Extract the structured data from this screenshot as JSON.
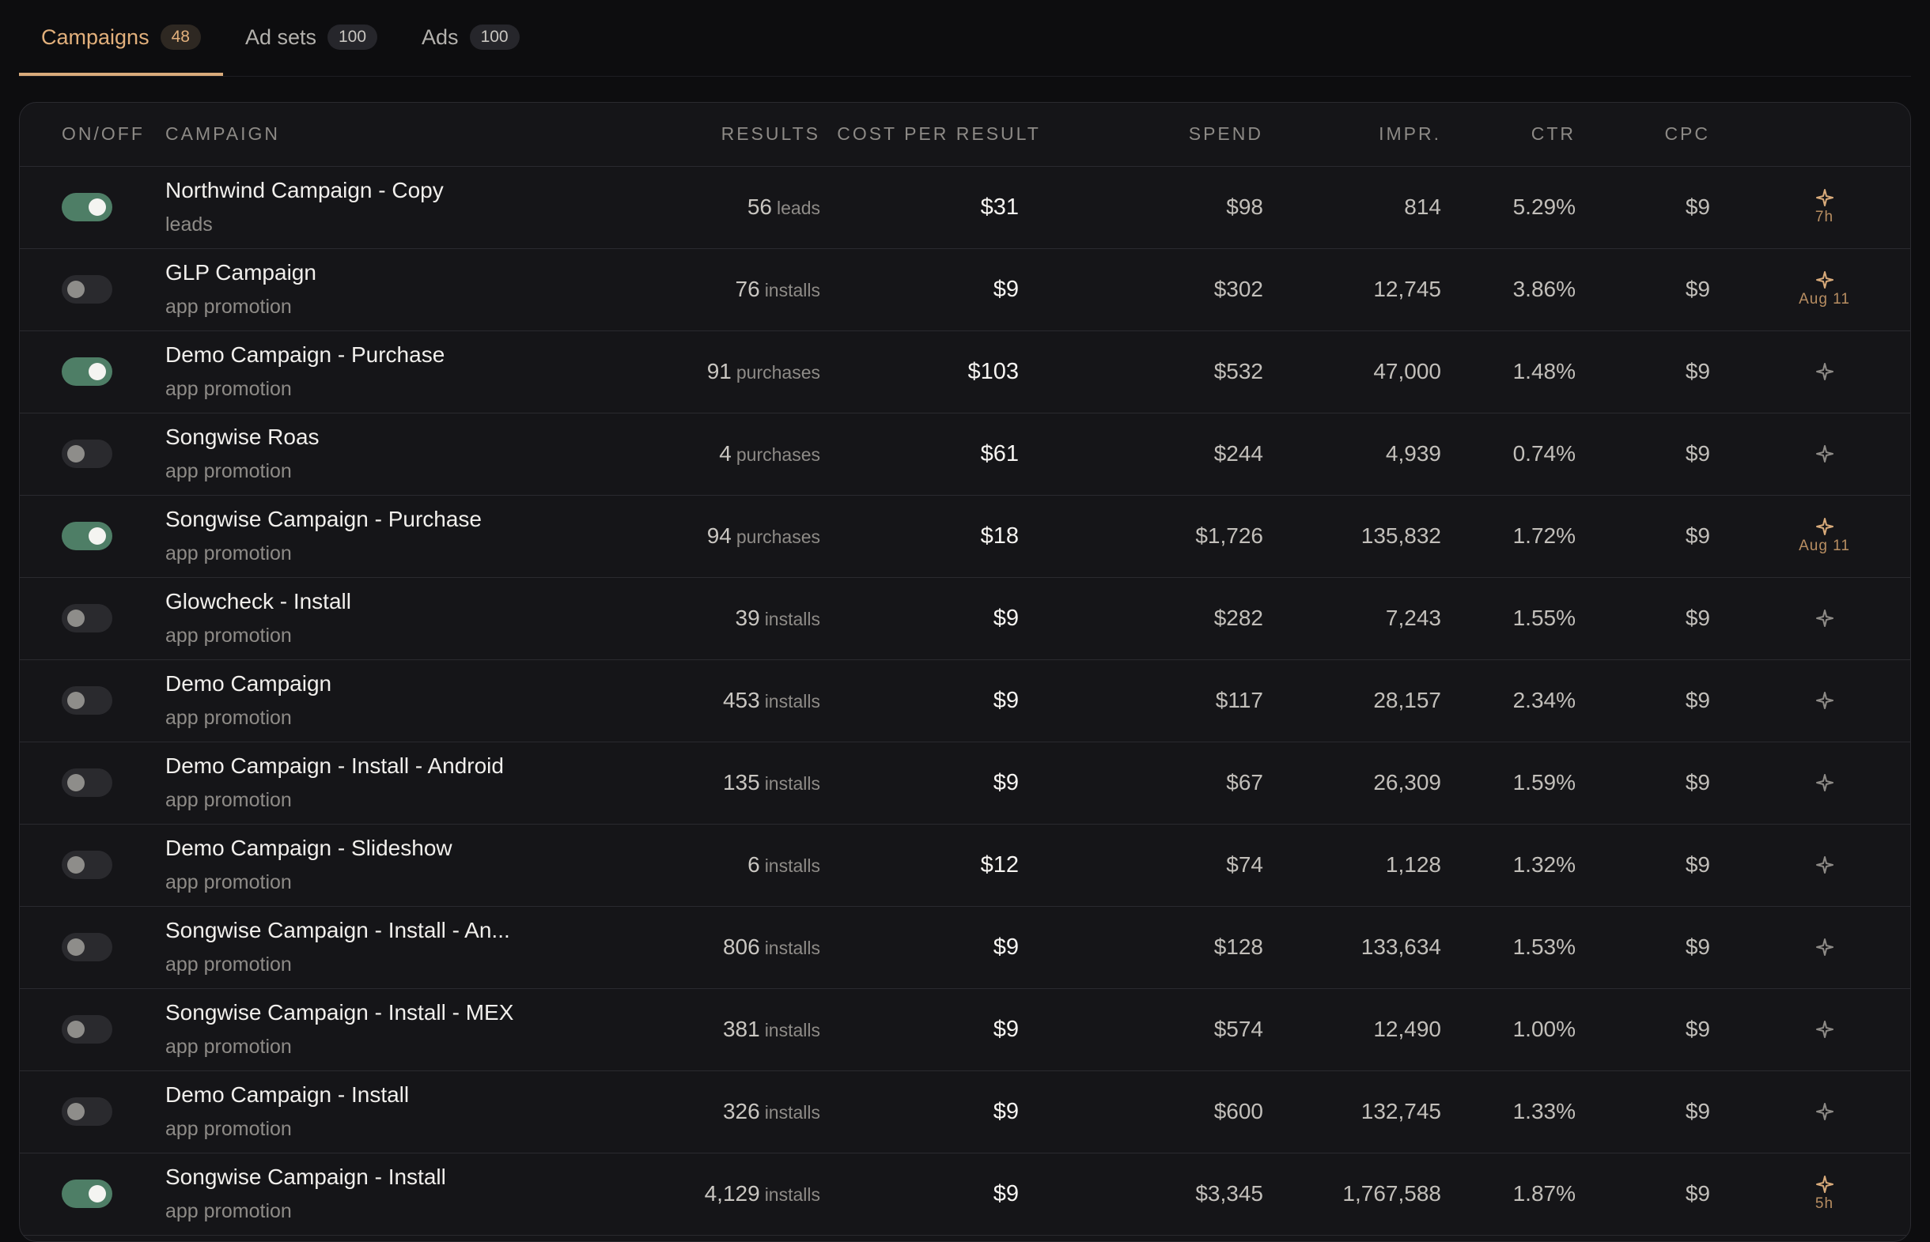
{
  "tabs": [
    {
      "label": "Campaigns",
      "count": "48",
      "active": true
    },
    {
      "label": "Ad sets",
      "count": "100",
      "active": false
    },
    {
      "label": "Ads",
      "count": "100",
      "active": false
    }
  ],
  "table": {
    "headers": {
      "onoff": "ON/OFF",
      "campaign": "CAMPAIGN",
      "results": "RESULTS",
      "cost_per_result": "COST PER RESULT",
      "spend": "SPEND",
      "impr": "IMPR.",
      "ctr": "CTR",
      "cpc": "CPC"
    },
    "rows": [
      {
        "on": true,
        "name": "Northwind Campaign - Copy",
        "objective": "leads",
        "results": "56",
        "results_unit": "leads",
        "cpr": "$31",
        "spend": "$98",
        "impr": "814",
        "ctr": "5.29%",
        "cpc": "$9",
        "action_label": "7h",
        "highlight": true
      },
      {
        "on": false,
        "name": "GLP Campaign",
        "objective": "app promotion",
        "results": "76",
        "results_unit": "installs",
        "cpr": "$9",
        "spend": "$302",
        "impr": "12,745",
        "ctr": "3.86%",
        "cpc": "$9",
        "action_label": "Aug 11",
        "highlight": true
      },
      {
        "on": true,
        "name": "Demo Campaign - Purchase",
        "objective": "app promotion",
        "results": "91",
        "results_unit": "purchases",
        "cpr": "$103",
        "spend": "$532",
        "impr": "47,000",
        "ctr": "1.48%",
        "cpc": "$9",
        "action_label": "",
        "highlight": false
      },
      {
        "on": false,
        "name": "Songwise Roas",
        "objective": "app promotion",
        "results": "4",
        "results_unit": "purchases",
        "cpr": "$61",
        "spend": "$244",
        "impr": "4,939",
        "ctr": "0.74%",
        "cpc": "$9",
        "action_label": "",
        "highlight": false
      },
      {
        "on": true,
        "name": "Songwise Campaign - Purchase",
        "objective": "app promotion",
        "results": "94",
        "results_unit": "purchases",
        "cpr": "$18",
        "spend": "$1,726",
        "impr": "135,832",
        "ctr": "1.72%",
        "cpc": "$9",
        "action_label": "Aug 11",
        "highlight": true
      },
      {
        "on": false,
        "name": "Glowcheck - Install",
        "objective": "app promotion",
        "results": "39",
        "results_unit": "installs",
        "cpr": "$9",
        "spend": "$282",
        "impr": "7,243",
        "ctr": "1.55%",
        "cpc": "$9",
        "action_label": "",
        "highlight": false
      },
      {
        "on": false,
        "name": "Demo Campaign",
        "objective": "app promotion",
        "results": "453",
        "results_unit": "installs",
        "cpr": "$9",
        "spend": "$117",
        "impr": "28,157",
        "ctr": "2.34%",
        "cpc": "$9",
        "action_label": "",
        "highlight": false
      },
      {
        "on": false,
        "name": "Demo Campaign - Install - Android",
        "objective": "app promotion",
        "results": "135",
        "results_unit": "installs",
        "cpr": "$9",
        "spend": "$67",
        "impr": "26,309",
        "ctr": "1.59%",
        "cpc": "$9",
        "action_label": "",
        "highlight": false
      },
      {
        "on": false,
        "name": "Demo Campaign - Slideshow",
        "objective": "app promotion",
        "results": "6",
        "results_unit": "installs",
        "cpr": "$12",
        "spend": "$74",
        "impr": "1,128",
        "ctr": "1.32%",
        "cpc": "$9",
        "action_label": "",
        "highlight": false
      },
      {
        "on": false,
        "name": "Songwise Campaign - Install - An...",
        "objective": "app promotion",
        "results": "806",
        "results_unit": "installs",
        "cpr": "$9",
        "spend": "$128",
        "impr": "133,634",
        "ctr": "1.53%",
        "cpc": "$9",
        "action_label": "",
        "highlight": false
      },
      {
        "on": false,
        "name": "Songwise Campaign - Install - MEX",
        "objective": "app promotion",
        "results": "381",
        "results_unit": "installs",
        "cpr": "$9",
        "spend": "$574",
        "impr": "12,490",
        "ctr": "1.00%",
        "cpc": "$9",
        "action_label": "",
        "highlight": false
      },
      {
        "on": false,
        "name": "Demo Campaign - Install",
        "objective": "app promotion",
        "results": "326",
        "results_unit": "installs",
        "cpr": "$9",
        "spend": "$600",
        "impr": "132,745",
        "ctr": "1.33%",
        "cpc": "$9",
        "action_label": "",
        "highlight": false
      },
      {
        "on": true,
        "name": "Songwise Campaign - Install",
        "objective": "app promotion",
        "results": "4,129",
        "results_unit": "installs",
        "cpr": "$9",
        "spend": "$3,345",
        "impr": "1,767,588",
        "ctr": "1.87%",
        "cpc": "$9",
        "action_label": "5h",
        "highlight": true
      }
    ]
  },
  "icons": {
    "action": "sparkle-icon"
  },
  "colors": {
    "accent": "#d9ab7b",
    "toggle_on": "#4e7e66",
    "sparkle_active": "#d9ab7b",
    "sparkle_inactive": "#8e8b87"
  }
}
